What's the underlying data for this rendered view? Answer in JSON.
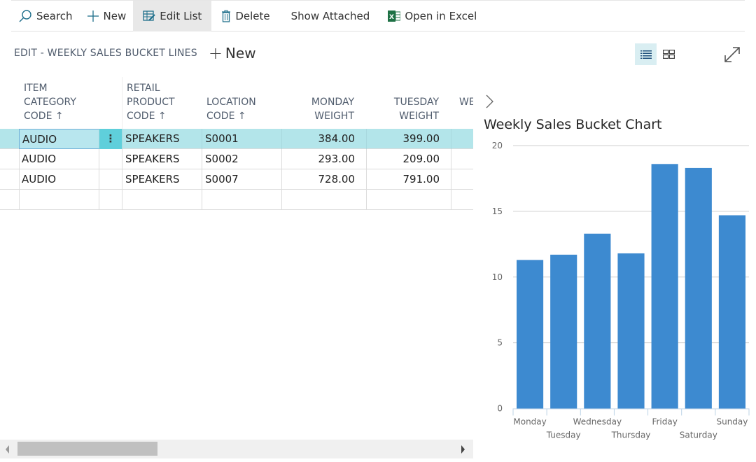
{
  "toolbar": {
    "search": "Search",
    "new": "New",
    "edit_list": "Edit List",
    "delete": "Delete",
    "show_attached": "Show Attached",
    "open_in_excel": "Open in Excel"
  },
  "page": {
    "title": "EDIT - WEEKLY SALES BUCKET LINES",
    "new_label": "New",
    "plus": "+"
  },
  "grid": {
    "columns": [
      {
        "label_lines": [
          "ITEM",
          "CATEGORY",
          "CODE ↑"
        ]
      },
      {
        "label_lines": [
          "RETAIL",
          "PRODUCT",
          "CODE ↑"
        ]
      },
      {
        "label_lines": [
          "LOCATION",
          "CODE ↑"
        ]
      },
      {
        "label_lines": [
          "MONDAY",
          "WEIGHT"
        ]
      },
      {
        "label_lines": [
          "TUESDAY",
          "WEIGHT"
        ]
      },
      {
        "label_lines": [
          "WE"
        ]
      }
    ],
    "rows": [
      {
        "item_category": "AUDIO",
        "retail_product": "SPEAKERS",
        "location": "S0001",
        "monday": "384.00",
        "tuesday": "399.00",
        "selected": true
      },
      {
        "item_category": "AUDIO",
        "retail_product": "SPEAKERS",
        "location": "S0002",
        "monday": "293.00",
        "tuesday": "209.00",
        "selected": false
      },
      {
        "item_category": "AUDIO",
        "retail_product": "SPEAKERS",
        "location": "S0007",
        "monday": "728.00",
        "tuesday": "791.00",
        "selected": false
      }
    ],
    "row_menu": "⋮"
  },
  "factbox": {
    "toggle": "›"
  },
  "colors": {
    "accent": "#00a3b0",
    "selected_row": "#b3e5ea",
    "bar": "#3d8ad0"
  },
  "chart_data": {
    "type": "bar",
    "title": "Weekly Sales Bucket Chart",
    "categories": [
      "Monday",
      "Tuesday",
      "Wednesday",
      "Thursday",
      "Friday",
      "Saturday",
      "Sunday"
    ],
    "values": [
      11.3,
      11.7,
      13.3,
      11.8,
      18.6,
      18.3,
      14.7
    ],
    "xlabel": "",
    "ylabel": "",
    "ylim": [
      0,
      20
    ],
    "yticks": [
      0,
      5,
      10,
      15,
      20
    ],
    "grid": true,
    "legend": "none"
  }
}
